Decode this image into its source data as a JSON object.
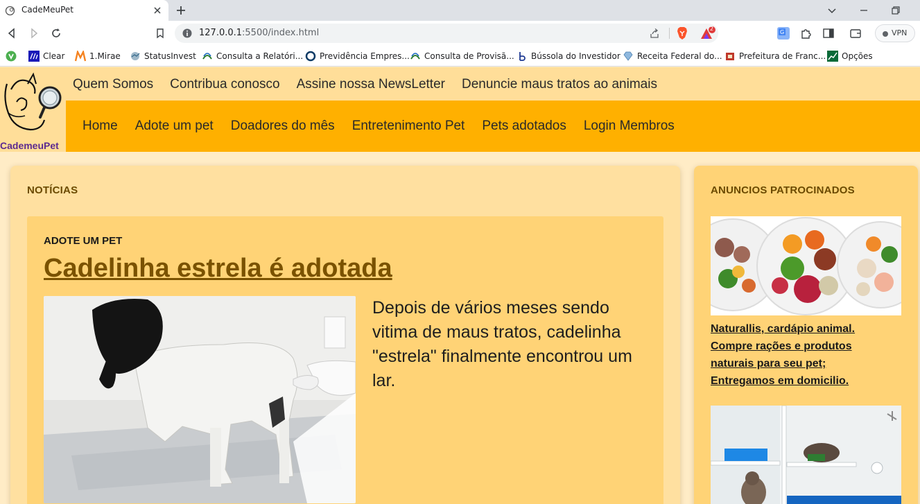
{
  "browser": {
    "tab_title": "CadeMeuPet",
    "url_host": "127.0.0.1",
    "url_rest": ":5500/index.html",
    "vpn_label": "VPN",
    "brave_badge": "2",
    "bookmarks": [
      {
        "label": "",
        "icon": "vivaldi-like-green-icon"
      },
      {
        "label": "Clear",
        "icon": "clear-icon"
      },
      {
        "label": "1.Mirae",
        "icon": "mirae-m-icon"
      },
      {
        "label": "StatusInvest",
        "icon": "statusinvest-icon"
      },
      {
        "label": "Consulta a Relatóri...",
        "icon": "gov-icon"
      },
      {
        "label": "Previdência Empres...",
        "icon": "circle-icon"
      },
      {
        "label": "Consulta de Provisã...",
        "icon": "gov-icon"
      },
      {
        "label": "Bússola do Investidor",
        "icon": "compass-b-icon"
      },
      {
        "label": "Receita Federal do...",
        "icon": "diamond-icon"
      },
      {
        "label": "Prefeitura de Franc...",
        "icon": "city-icon"
      },
      {
        "label": "Opções",
        "icon": "chart-icon"
      }
    ]
  },
  "site": {
    "logo_text": "CademeuPet",
    "top_nav": [
      "Quem Somos",
      "Contribua conosco",
      "Assine nossa NewsLetter",
      "Denuncie maus tratos ao animais"
    ],
    "main_nav": [
      "Home",
      "Adote um pet",
      "Doadores do mês",
      "Entretenimento Pet",
      "Pets adotados",
      "Login Membros"
    ]
  },
  "news": {
    "section_title": "NOTÍCIAS",
    "article": {
      "category": "ADOTE UM PET",
      "title": "Cadelinha estrela é adotada",
      "body": "Depois de vários meses sendo vitima de maus tratos, cadelinha \"estrela\" finalmente encontrou um lar."
    }
  },
  "ads": {
    "section_title": "ANUNCIOS PATROCINADOS",
    "ad1_text": "Naturallis, cardápio animal. Compre rações e produtos naturais para seu pet; Entregamos em domicilio."
  },
  "colors": {
    "header_bg": "#ffde99",
    "nav_bg": "#ffb000",
    "page_bg": "#ffecc6",
    "card_bg": "#ffd376",
    "title_brown": "#7a5200",
    "logo_purple": "#5c2a90"
  }
}
